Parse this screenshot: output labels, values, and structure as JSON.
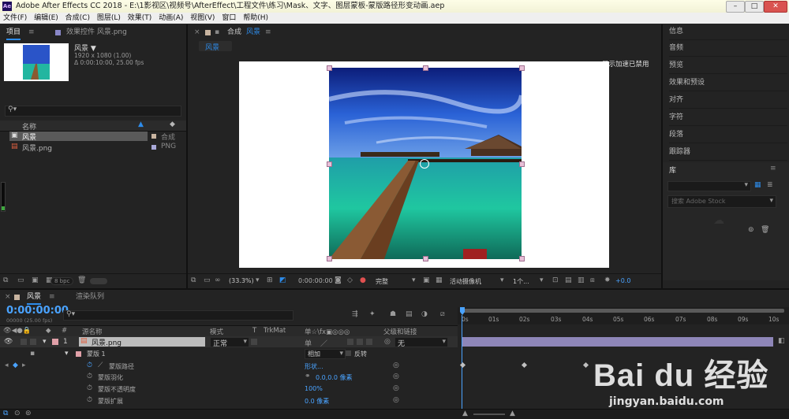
{
  "app": {
    "title": "Adobe After Effects CC 2018 - E:\\1影视区\\视频号\\AfterEffect\\工程文件\\练习\\Mask、文字、图层蒙板-蒙版路径形变动画.aep",
    "logo": "Ae"
  },
  "menu": [
    "文件(F)",
    "编辑(E)",
    "合成(C)",
    "图层(L)",
    "效果(T)",
    "动画(A)",
    "视图(V)",
    "窗口",
    "帮助(H)"
  ],
  "project_panel": {
    "tab_project": "项目",
    "tab_effects": "效果控件 风景.png",
    "asset_name": "风景 ▼",
    "asset_info1": "1920 x 1080 (1.00)",
    "asset_info2": "Δ 0:00:10:00, 25.00 fps",
    "search_placeholder": "",
    "col_name": "名称",
    "items": [
      {
        "name": "风景",
        "type": "合成"
      },
      {
        "name": "风景.png",
        "type": "PNG"
      }
    ],
    "bpc": "8 bpc"
  },
  "comp_panel": {
    "tab_label": "合成",
    "tab_name": "风景",
    "breadcrumb": "风景",
    "gpu_notice": "显示加速已禁用",
    "zoom": "(33.3%)",
    "timecode": "0:00:00:00",
    "quality": "完整",
    "camera": "活动摄像机",
    "views": "1个...",
    "exposure": "+0.0"
  },
  "right_panel": {
    "items": [
      "信息",
      "音频",
      "预览",
      "效果和预设",
      "对齐",
      "字符",
      "段落",
      "跟踪器"
    ],
    "library_label": "库",
    "stock_placeholder": "搜索 Adobe Stock"
  },
  "timeline": {
    "tab_comp": "风景",
    "tab_render": "渲染队列",
    "timecode": "0:00:00:00",
    "timecode_sub": "00000 (25.00 fps)",
    "cols": {
      "num": "#",
      "source": "源名称",
      "mode": "模式",
      "t": "T",
      "trkmat": "TrkMat",
      "switches": "单☆\\fx▣◎◎◎",
      "parent": "父级和链接"
    },
    "layer": {
      "num": "1",
      "name": "风景.png",
      "mode": "正常",
      "parent": "无"
    },
    "mask": {
      "name": "蒙版 1",
      "mode": "相加",
      "invert_label": "反转"
    },
    "props": [
      {
        "name": "蒙版路径",
        "value": "形状..."
      },
      {
        "name": "蒙版羽化",
        "value": "0.0,0.0 像素"
      },
      {
        "name": "蒙版不透明度",
        "value": "100%"
      },
      {
        "name": "蒙版扩展",
        "value": "0.0 像素"
      }
    ],
    "ticks": [
      "0s",
      "01s",
      "02s",
      "03s",
      "04s",
      "05s",
      "06s",
      "07s",
      "08s",
      "09s",
      "10s"
    ]
  },
  "watermark": {
    "brand": "Bai du 经验",
    "url": "jingyan.baidu.com"
  },
  "colors": {
    "accent": "#2d8ceb",
    "layer_bar": "#8e86b8",
    "panel": "#232323"
  }
}
